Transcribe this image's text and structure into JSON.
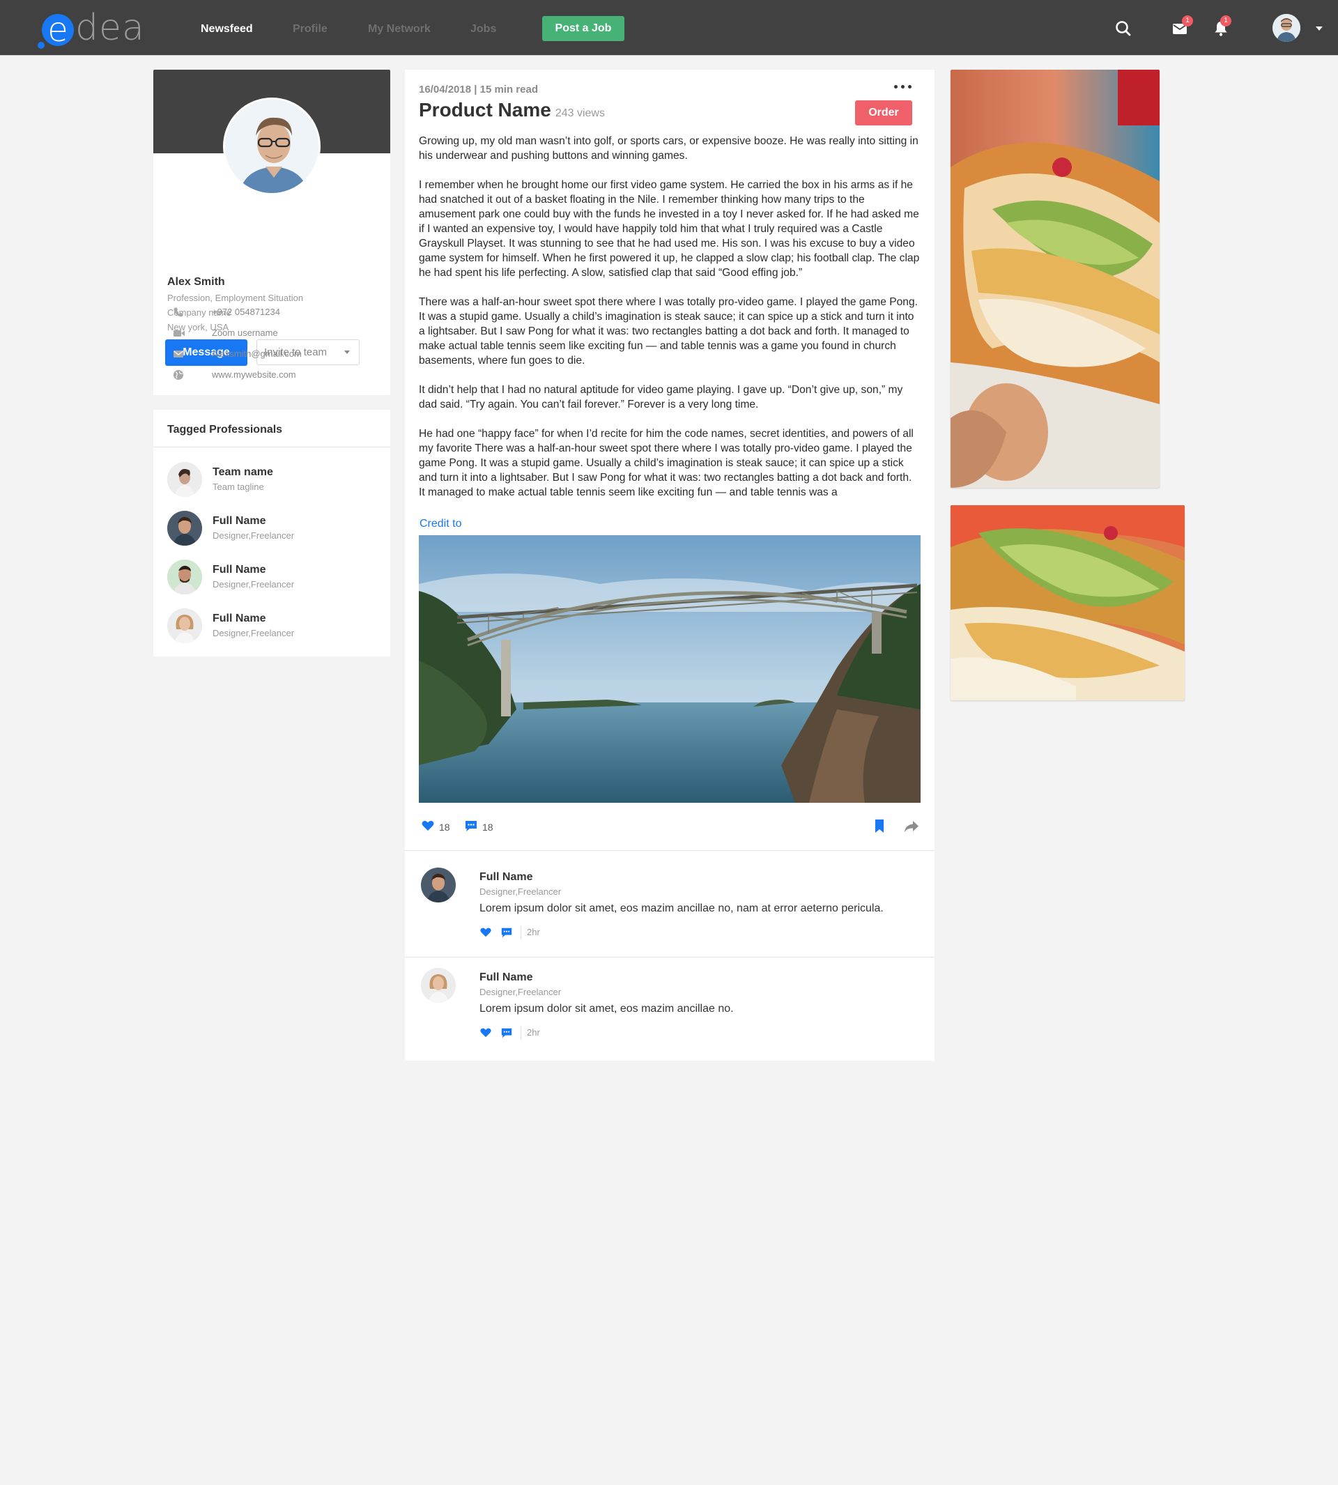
{
  "header": {
    "logo_text": "edea",
    "nav": [
      "Newsfeed",
      "Profile",
      "My Network",
      "Jobs"
    ],
    "post_job_label": "Post a Job",
    "messages_badge": "1",
    "notifications_badge": "1",
    "colors": {
      "bar": "#414141",
      "accent": "#1877f2",
      "post_job": "#46b276",
      "badge": "#f05a62"
    }
  },
  "profile": {
    "name": "Alex Smith",
    "profession": "Profession, Employment Situation",
    "company": "Company name",
    "location": "New york, USA",
    "message_label": "Message",
    "invite_label": "Invite to team",
    "contacts": {
      "phone": "+972 054871234",
      "zoom": "Zoom username",
      "email": "Alexsmith@gmail.com",
      "website": "www.mywebsite.com"
    }
  },
  "tagged": {
    "title": "Tagged Professionals",
    "people": [
      {
        "name": "Team name",
        "desc": "Team tagline"
      },
      {
        "name": "Full Name",
        "desc": "Designer,Freelancer"
      },
      {
        "name": "Full Name",
        "desc": "Designer,Freelancer"
      },
      {
        "name": "Full Name",
        "desc": "Designer,Freelancer"
      }
    ]
  },
  "post": {
    "meta": "16/04/2018 | 15 min read",
    "title": "Product Name",
    "views": "243 views",
    "order_label": "Order",
    "paragraphs": [
      "Growing up, my old man wasn’t into golf, or sports cars, or expensive booze. He was really into sitting in his underwear and pushing buttons and winning games.",
      "I remember when he brought home our first video game system. He carried the box in his arms as if he had snatched it out of a basket floating in the Nile. I remember thinking how many trips to the amusement park one could buy with the funds he invested in a toy I never asked for. If he had asked me if I wanted an expensive toy, I would have happily told him that what I truly required was a Castle Grayskull Playset. It was stunning to see that he had used me. His son. I was his excuse to buy a video game system for himself. When he first powered it up, he clapped a slow clap; his football clap. The clap he had spent his life perfecting. A slow, satisfied clap that said “Good effing job.”",
      "There was a half-an-hour sweet spot there where I was totally pro-video game. I played the game Pong. It was a stupid game. Usually a child’s imagination is steak sauce; it can spice up a stick and turn it into a lightsaber. But I saw Pong for what it was: two rectangles batting a dot back and forth. It managed to make actual table tennis seem like exciting fun — and table tennis was a game you found in church basements, where fun goes to die.",
      "It didn’t help that I had no natural aptitude for video game playing. I gave up. “Don’t give up, son,” my dad said. “Try  again. You can’t fail forever.” Forever is a very long time.",
      "He had one “happy face” for when I’d recite for him the code names, secret identities, and powers of all my favorite There was a half-an-hour sweet spot there where I was totally pro-video game. I played the game Pong. It was a stupid game. Usually a child’s imagination is steak sauce; it can spice up a stick and turn it into a lightsaber. But I saw Pong for what it was: two rectangles batting a dot back and forth. It managed to make actual table tennis seem like exciting fun — and table tennis was a"
    ],
    "credit": "Credit to",
    "likes": "18",
    "comments_count": "18"
  },
  "comments": [
    {
      "name": "Full Name",
      "desc": "Designer,Freelancer",
      "text": "Lorem ipsum dolor sit amet, eos mazim ancillae no, nam at error aeterno pericula.",
      "time": "2hr"
    },
    {
      "name": "Full Name",
      "desc": "Designer,Freelancer",
      "text": "Lorem ipsum dolor sit amet, eos mazim ancillae no.",
      "time": "2hr"
    }
  ]
}
